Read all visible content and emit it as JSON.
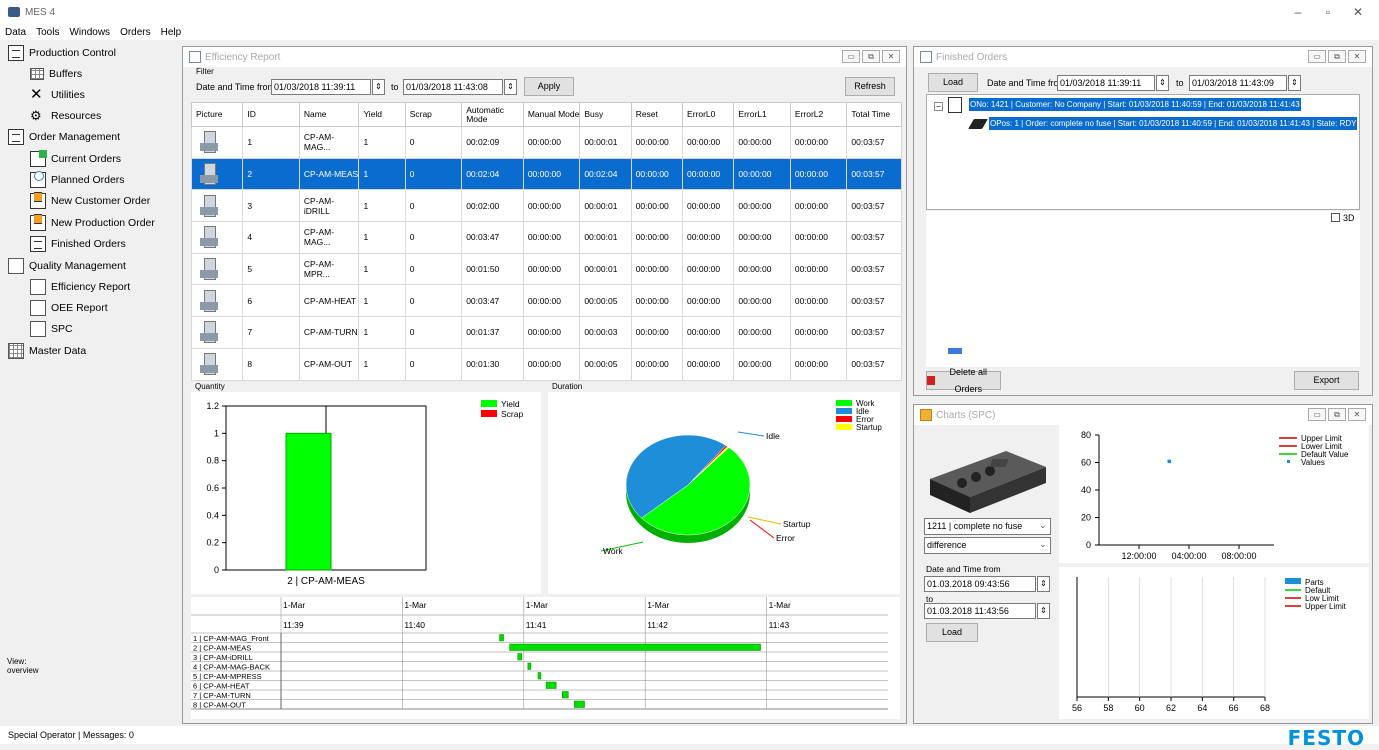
{
  "app": {
    "title": "MES 4",
    "menu": [
      "Data",
      "Tools",
      "Windows",
      "Orders",
      "Help"
    ],
    "window_min": "–",
    "window_max": "▫",
    "window_close": "✕"
  },
  "nav": {
    "items": [
      {
        "label": "Production Control",
        "icon": "production-control-icon"
      },
      {
        "label": "Buffers",
        "icon": "buffers-icon"
      },
      {
        "label": "Utilities",
        "icon": "utilities-icon"
      },
      {
        "label": "Resources",
        "icon": "resources-icon"
      },
      {
        "label": "Order Management",
        "icon": "order-management-icon"
      },
      {
        "label": "Current Orders",
        "icon": "current-orders-icon"
      },
      {
        "label": "Planned Orders",
        "icon": "planned-orders-icon"
      },
      {
        "label": "New Customer Order",
        "icon": "new-customer-order-icon"
      },
      {
        "label": "New Production Order",
        "icon": "new-production-order-icon"
      },
      {
        "label": "Finished Orders",
        "icon": "finished-orders-icon"
      },
      {
        "label": "Quality Management",
        "icon": "quality-management-icon"
      },
      {
        "label": "Efficiency Report",
        "icon": "efficiency-report-icon"
      },
      {
        "label": "OEE Report",
        "icon": "oee-report-icon"
      },
      {
        "label": "SPC",
        "icon": "spc-icon"
      },
      {
        "label": "Master Data",
        "icon": "master-data-icon"
      }
    ],
    "view_label": "View:",
    "view_value": "overview"
  },
  "efficiency": {
    "title": "Efficiency Report",
    "filter_label": "Filter",
    "date_from_label": "Date and Time from",
    "date_from": "01/03/2018 11:39:11",
    "to_label": "to",
    "date_to": "01/03/2018 11:43:08",
    "apply": "Apply",
    "refresh": "Refresh",
    "columns": [
      "Picture",
      "ID",
      "Name",
      "Yield",
      "Scrap",
      "Automatic Mode",
      "Manual Mode",
      "Busy",
      "Reset",
      "ErrorL0",
      "ErrorL1",
      "ErrorL2",
      "Total Time"
    ],
    "rows": [
      [
        "1",
        "CP-AM-MAG...",
        "1",
        "0",
        "00:02:09",
        "00:00:00",
        "00:00:01",
        "00:00:00",
        "00:00:00",
        "00:00:00",
        "00:00:00",
        "00:03:57"
      ],
      [
        "2",
        "CP-AM-MEAS",
        "1",
        "0",
        "00:02:04",
        "00:00:00",
        "00:02:04",
        "00:00:00",
        "00:00:00",
        "00:00:00",
        "00:00:00",
        "00:03:57"
      ],
      [
        "3",
        "CP-AM-iDRILL",
        "1",
        "0",
        "00:02:00",
        "00:00:00",
        "00:00:01",
        "00:00:00",
        "00:00:00",
        "00:00:00",
        "00:00:00",
        "00:03:57"
      ],
      [
        "4",
        "CP-AM-MAG...",
        "1",
        "0",
        "00:03:47",
        "00:00:00",
        "00:00:01",
        "00:00:00",
        "00:00:00",
        "00:00:00",
        "00:00:00",
        "00:03:57"
      ],
      [
        "5",
        "CP-AM-MPR...",
        "1",
        "0",
        "00:01:50",
        "00:00:00",
        "00:00:01",
        "00:00:00",
        "00:00:00",
        "00:00:00",
        "00:00:00",
        "00:03:57"
      ],
      [
        "6",
        "CP-AM-HEAT",
        "1",
        "0",
        "00:03:47",
        "00:00:00",
        "00:00:05",
        "00:00:00",
        "00:00:00",
        "00:00:00",
        "00:00:00",
        "00:03:57"
      ],
      [
        "7",
        "CP-AM-TURN",
        "1",
        "0",
        "00:01:37",
        "00:00:00",
        "00:00:03",
        "00:00:00",
        "00:00:00",
        "00:00:00",
        "00:00:00",
        "00:03:57"
      ],
      [
        "8",
        "CP-AM-OUT",
        "1",
        "0",
        "00:01:30",
        "00:00:00",
        "00:00:05",
        "00:00:00",
        "00:00:00",
        "00:00:00",
        "00:00:00",
        "00:03:57"
      ]
    ],
    "selected_row": 1,
    "quantity_label": "Quantity",
    "duration_label": "Duration"
  },
  "chart_data": [
    {
      "type": "bar",
      "categories": [
        "2 | CP-AM-MEAS"
      ],
      "series": [
        {
          "name": "Yield",
          "values": [
            1
          ],
          "color": "#00ff00"
        },
        {
          "name": "Scrap",
          "values": [
            0
          ],
          "color": "#ff0000"
        }
      ],
      "ylim": [
        0,
        1.2
      ],
      "yticks": [
        "1.2",
        "1",
        "0.8",
        "0.6",
        "0.4",
        "0.2",
        "0"
      ],
      "legend": "top-right",
      "grid": true
    },
    {
      "type": "pie",
      "series": [
        {
          "name": "Work",
          "value": 0.52,
          "color": "#00ff00"
        },
        {
          "name": "Idle",
          "value": 0.47,
          "color": "#1e8ed8"
        },
        {
          "name": "Error",
          "value": 0.005,
          "color": "#ff0000"
        },
        {
          "name": "Startup",
          "value": 0.005,
          "color": "#ffff00"
        }
      ],
      "slice_labels": [
        "Work",
        "Idle",
        "Startup",
        "Error"
      ],
      "legend": "top-right"
    },
    {
      "type": "gantt",
      "x_top": [
        "1-Mar",
        "1-Mar",
        "1-Mar",
        "1-Mar",
        "1-Mar"
      ],
      "x_bottom": [
        "11:39",
        "11:40",
        "11:41",
        "11:42",
        "11:43"
      ],
      "xrange": [
        "11:39",
        "11:44"
      ],
      "rows": [
        {
          "label": "1 | CP-AM-MAG_Front",
          "start": "11:40:48",
          "end": "11:40:50"
        },
        {
          "label": "2 | CP-AM-MEAS",
          "start": "11:40:53",
          "end": "11:42:57"
        },
        {
          "label": "3 | CP-AM-iDRILL",
          "start": "11:40:57",
          "end": "11:40:59"
        },
        {
          "label": "4 | CP-AM-MAG-BACK",
          "start": "11:41:02",
          "end": "11:41:03"
        },
        {
          "label": "5 | CP-AM-MPRESS",
          "start": "11:41:07",
          "end": "11:41:08"
        },
        {
          "label": "6 | CP-AM-HEAT",
          "start": "11:41:11",
          "end": "11:41:16"
        },
        {
          "label": "7 | CP-AM-TURN",
          "start": "11:41:19",
          "end": "11:41:22"
        },
        {
          "label": "8 | CP-AM-OUT",
          "start": "11:41:25",
          "end": "11:41:30"
        }
      ],
      "color": "#00dd00"
    },
    {
      "type": "scatter",
      "title": "",
      "ylim": [
        0,
        80
      ],
      "yticks": [
        "80",
        "60",
        "40",
        "20",
        "0"
      ],
      "xticks": [
        "12:00:00",
        "04:00:00",
        "08:00:00"
      ],
      "series": [
        {
          "name": "Upper Limit",
          "color": "#cc0000",
          "values": []
        },
        {
          "name": "Lower Limit",
          "color": "#cc0000",
          "values": []
        },
        {
          "name": "Default Value",
          "color": "#00cc00",
          "values": []
        },
        {
          "name": "Values",
          "color": "#1e8ed8",
          "values": [
            {
              "x": "03:00:00",
              "y": 61
            }
          ]
        }
      ],
      "legend": "top-right"
    },
    {
      "type": "bar",
      "xlim": [
        56,
        68
      ],
      "xticks": [
        "56",
        "58",
        "60",
        "62",
        "64",
        "66",
        "68"
      ],
      "series": [
        {
          "name": "Parts",
          "color": "#1e8ed8",
          "values": []
        },
        {
          "name": "Default",
          "color": "#00cc00",
          "values": []
        },
        {
          "name": "Low Limit",
          "color": "#cc0000",
          "values": []
        },
        {
          "name": "Upper Limit",
          "color": "#cc0000",
          "values": []
        }
      ],
      "legend": "top-right"
    }
  ],
  "finished": {
    "title": "Finished Orders",
    "load": "Load",
    "date_from_label": "Date and Time from",
    "date_from": "01/03/2018 11:39:11",
    "to_label": "to",
    "date_to": "01/03/2018 11:43:09",
    "tree_root": "ONo: 1421 | Customer: No Company | Start: 01/03/2018 11:40:59 | End: 01/03/2018 11:41:43",
    "tree_child": "OPos: 1 | Order: complete no fuse | Start: 01/03/2018 11:40:59 | End: 01/03/2018 11:41:43 | State: RDY",
    "check_3d": "3D",
    "delete_all": "Delete all Orders",
    "export": "Export"
  },
  "spc": {
    "title": "Charts (SPC)",
    "part_select": "1211 | complete no fuse",
    "mode_select": "difference",
    "from_label": "Date and Time from",
    "from_value": "01.03.2018 09:43:56",
    "to_label": "to",
    "to_value": "01.03.2018 11:43:56",
    "load": "Load"
  },
  "status": {
    "text": "Special Operator   | Messages: 0",
    "brand": "FESTO",
    "brand_color": "#0091dc"
  }
}
